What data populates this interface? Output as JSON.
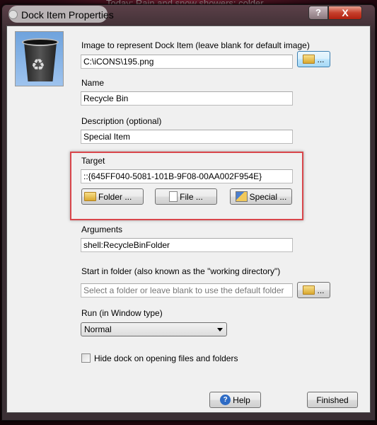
{
  "background_text": "Today: Rain and snow showers; colder",
  "window": {
    "title": "Dock Item Properties",
    "help_glyph": "?",
    "close_glyph": "X"
  },
  "image": {
    "label": "Image to represent Dock Item (leave blank for default image)",
    "value": "C:\\iCONS\\195.png",
    "browse_label": "..."
  },
  "name": {
    "label": "Name",
    "value": "Recycle Bin"
  },
  "description": {
    "label": "Description (optional)",
    "value": "Special Item"
  },
  "target": {
    "label": "Target",
    "value": "::{645FF040-5081-101B-9F08-00AA002F954E}",
    "folder_label": "Folder ...",
    "file_label": "File ...",
    "special_label": "Special ..."
  },
  "arguments": {
    "label": "Arguments",
    "value": "shell:RecycleBinFolder"
  },
  "start_in": {
    "label": "Start in folder (also known as the \"working directory\")",
    "placeholder": "Select a folder or leave blank to use the default folder",
    "browse_label": "..."
  },
  "run": {
    "label": "Run (in  Window type)",
    "selected": "Normal"
  },
  "hide_dock": {
    "label": "Hide dock on opening files and folders",
    "checked": false
  },
  "footer": {
    "help_label": "Help",
    "finished_label": "Finished"
  },
  "colors": {
    "highlight_box": "#d9464b",
    "close_button": "#c6402c"
  }
}
